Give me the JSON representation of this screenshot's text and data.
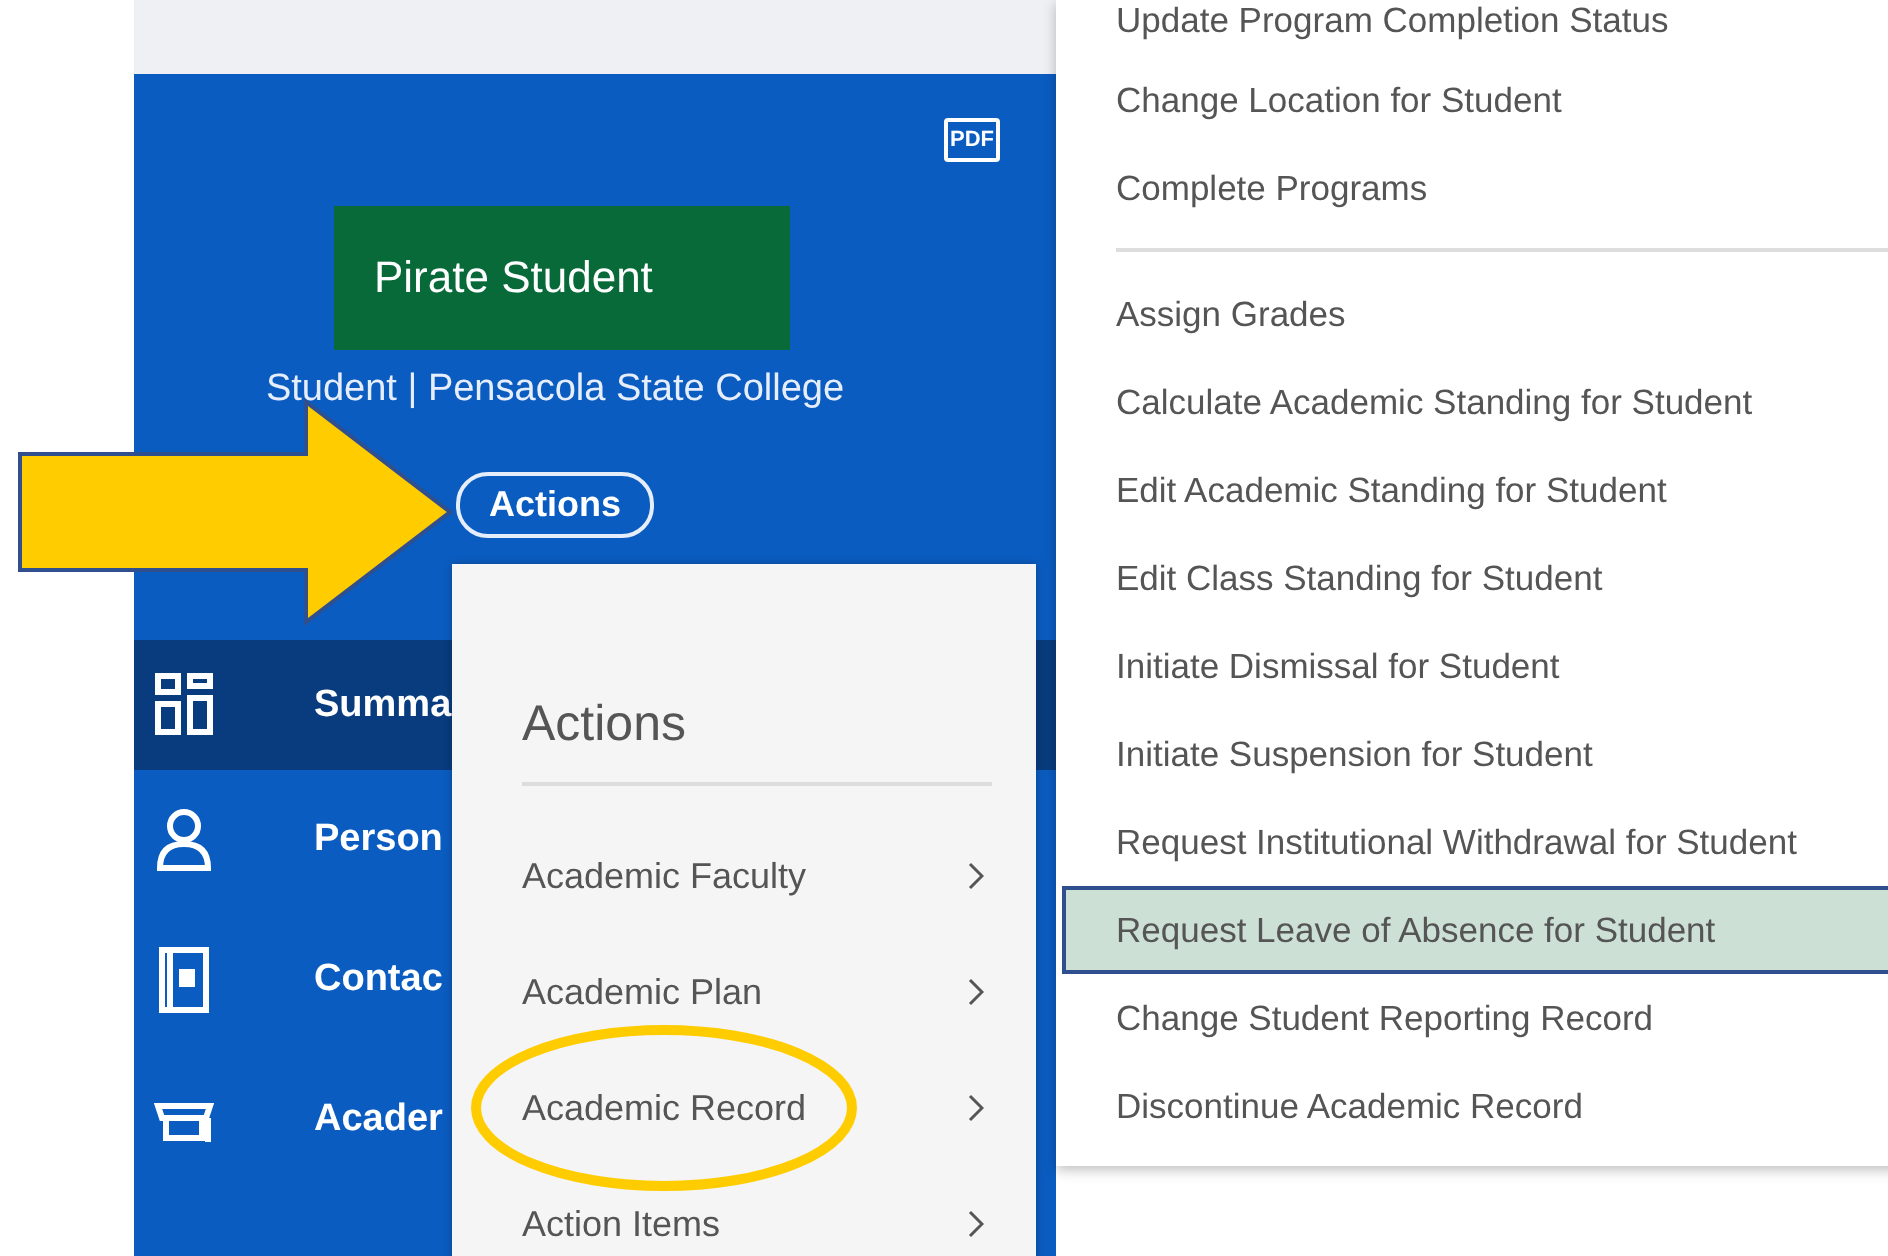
{
  "profile": {
    "pdf_label": "PDF",
    "annotation_label": "Pirate Student",
    "subtitle": "Student | Pensacola State College",
    "actions_button": "Actions"
  },
  "sidebar": [
    {
      "label": "Summa",
      "kind": "grid",
      "selected": true
    },
    {
      "label": "Person",
      "kind": "person",
      "selected": false
    },
    {
      "label": "Contac",
      "kind": "contact",
      "selected": false
    },
    {
      "label": "Acader",
      "kind": "academic",
      "selected": false
    }
  ],
  "actions_menu": {
    "title": "Actions",
    "items": [
      {
        "label": "Academic Faculty",
        "circled": false
      },
      {
        "label": "Academic Plan",
        "circled": false
      },
      {
        "label": "Academic Record",
        "circled": true
      },
      {
        "label": "Action Items",
        "circled": false
      }
    ]
  },
  "submenu": {
    "sections": [
      [
        {
          "label": "Update Program Completion Status",
          "highlighted": false
        },
        {
          "label": "Change Location for Student",
          "highlighted": false
        },
        {
          "label": "Complete Programs",
          "highlighted": false
        }
      ],
      [
        {
          "label": "Assign Grades",
          "highlighted": false
        },
        {
          "label": "Calculate Academic Standing for Student",
          "highlighted": false
        },
        {
          "label": "Edit Academic Standing for Student",
          "highlighted": false
        },
        {
          "label": "Edit Class Standing for Student",
          "highlighted": false
        },
        {
          "label": "Initiate Dismissal for Student",
          "highlighted": false
        },
        {
          "label": "Initiate Suspension for Student",
          "highlighted": false
        },
        {
          "label": "Request Institutional Withdrawal for Student",
          "highlighted": false
        },
        {
          "label": "Request Leave of Absence for Student",
          "highlighted": true
        },
        {
          "label": "Change Student Reporting Record",
          "highlighted": false
        },
        {
          "label": "Discontinue Academic Record",
          "highlighted": false
        }
      ]
    ]
  }
}
